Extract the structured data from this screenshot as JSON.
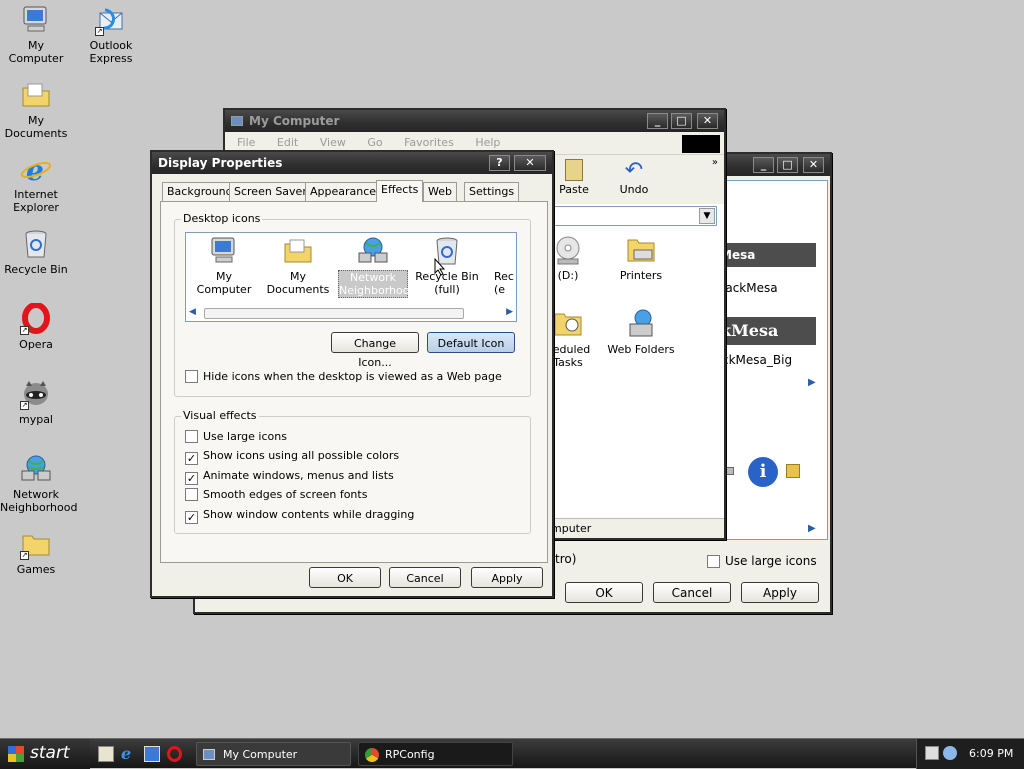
{
  "desktop": {
    "icons": [
      {
        "label": "My Computer"
      },
      {
        "label": "Outlook Express"
      },
      {
        "label": "My Documents"
      },
      {
        "label": "Internet Explorer"
      },
      {
        "label": "Recycle Bin"
      },
      {
        "label": "Opera"
      },
      {
        "label": "mypal"
      },
      {
        "label": "Network Neighborhood"
      },
      {
        "label": "Games"
      }
    ]
  },
  "mycomputer": {
    "title": "My Computer",
    "menu": [
      "File",
      "Edit",
      "View",
      "Go",
      "Favorites",
      "Help"
    ],
    "toolbar": {
      "paste": "Paste",
      "undo": "Undo"
    },
    "items": [
      {
        "label": "(D:)"
      },
      {
        "label": "Printers"
      },
      {
        "label": "heduled Tasks"
      },
      {
        "label": "Web Folders"
      }
    ],
    "status": "mputer"
  },
  "rear_dialog": {
    "schemes": [
      "lackMesa",
      "kMesa",
      "ckMesa_Big"
    ],
    "fragment_a": "tro)",
    "fragment_b": "a",
    "use_large_icons": "Use large icons",
    "ok": "OK",
    "cancel": "Cancel",
    "apply": "Apply"
  },
  "display_properties": {
    "title": "Display Properties",
    "tabs": [
      "Background",
      "Screen Saver",
      "Appearance",
      "Effects",
      "Web",
      "Settings"
    ],
    "active_tab": "Effects",
    "desktop_icons": {
      "legend": "Desktop icons",
      "items": [
        {
          "label": "My Computer"
        },
        {
          "label": "My Documents"
        },
        {
          "label": "Network Neighborhood"
        },
        {
          "label": "Recycle Bin (full)"
        },
        {
          "label": "Rec (e"
        }
      ],
      "change_icon": "Change Icon...",
      "default_icon": "Default Icon",
      "hide_icons": {
        "label": "Hide icons when the desktop is viewed as a Web page",
        "checked": false
      }
    },
    "visual_effects": {
      "legend": "Visual effects",
      "options": [
        {
          "label": "Use large icons",
          "checked": false
        },
        {
          "label": "Show icons using all possible colors",
          "checked": true
        },
        {
          "label": "Animate windows, menus and lists",
          "checked": true
        },
        {
          "label": "Smooth edges of screen fonts",
          "checked": false
        },
        {
          "label": "Show window contents while dragging",
          "checked": true
        }
      ]
    },
    "buttons": {
      "ok": "OK",
      "cancel": "Cancel",
      "apply": "Apply"
    }
  },
  "taskbar": {
    "start": "start",
    "tasks": [
      {
        "label": "My Computer"
      },
      {
        "label": "RPConfig"
      }
    ],
    "clock": "6:09 PM"
  }
}
